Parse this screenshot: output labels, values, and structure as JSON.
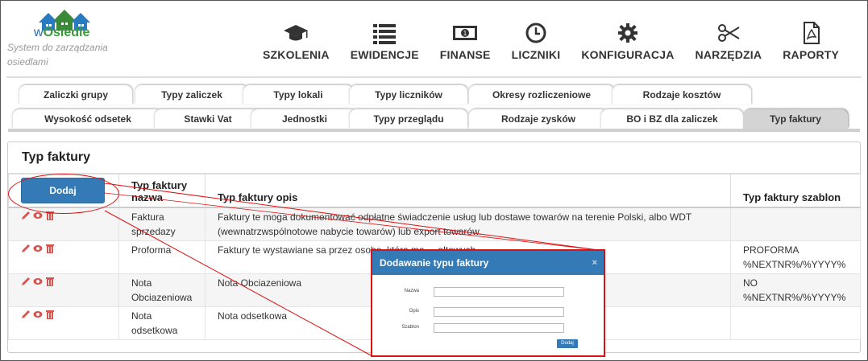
{
  "header": {
    "app_name": "wOsiedle",
    "app_name_prefix": "w",
    "app_name_rest": "Osiedle",
    "tagline": "System do zarządzania osiedlami",
    "nav": [
      {
        "label": "SZKOLENIA",
        "icon": "graduation-cap-icon"
      },
      {
        "label": "EWIDENCJE",
        "icon": "list-icon"
      },
      {
        "label": "FINANSE",
        "icon": "money-icon"
      },
      {
        "label": "LICZNIKI",
        "icon": "clock-icon"
      },
      {
        "label": "KONFIGURACJA",
        "icon": "gear-icon"
      },
      {
        "label": "NARZĘDZIA",
        "icon": "scissors-icon"
      },
      {
        "label": "RAPORTY",
        "icon": "pdf-file-icon"
      }
    ]
  },
  "tabs": {
    "row1": [
      "Zaliczki grupy",
      "Typy zaliczek",
      "Typy lokali",
      "Typy liczników",
      "Okresy rozliczeniowe",
      "Rodzaje kosztów"
    ],
    "row2": [
      "Wysokość odsetek",
      "Stawki Vat",
      "Jednostki",
      "Typy przeglądu",
      "Rodzaje zysków",
      "BO i BZ dla zaliczek",
      "Typ faktury"
    ],
    "active": "Typ faktury"
  },
  "panel": {
    "title": "Typ faktury",
    "add_button": "Dodaj",
    "columns": [
      "Typ faktury nazwa",
      "Typ faktury opis",
      "Typ faktury szablon"
    ],
    "rows": [
      {
        "nazwa": "Faktura sprzedazy",
        "opis": "Faktury te moga dokumentować odpłatne świadczenie usług lub dostawe towarów na terenie Polski, albo WDT (wewnatrzwspólnotowe nabycie towarów) lub export towarów.",
        "szablon": ""
      },
      {
        "nazwa": "Proforma",
        "opis": "Faktury te wystawiane sa przez osobe, która ma ... altowych.",
        "szablon": "PROFORMA %NEXTNR%/%YYYY%"
      },
      {
        "nazwa": "Nota Obciazeniowa",
        "opis": "Nota Obciazeniowa",
        "szablon": "NO %NEXTNR%/%YYYY%"
      },
      {
        "nazwa": "Nota odsetkowa",
        "opis": "Nota odsetkowa",
        "szablon": ""
      }
    ]
  },
  "modal": {
    "title": "Dodawanie typu faktury",
    "close": "×",
    "fields": [
      {
        "label": "Nazwa",
        "value": ""
      },
      {
        "label": "Opis",
        "value": ""
      },
      {
        "label": "Szablon",
        "value": ""
      }
    ],
    "submit": "Dodaj"
  },
  "colors": {
    "primary": "#337ab7",
    "highlight": "#dd1111",
    "edit_icon": "#d9534f",
    "view_icon": "#d9534f"
  }
}
